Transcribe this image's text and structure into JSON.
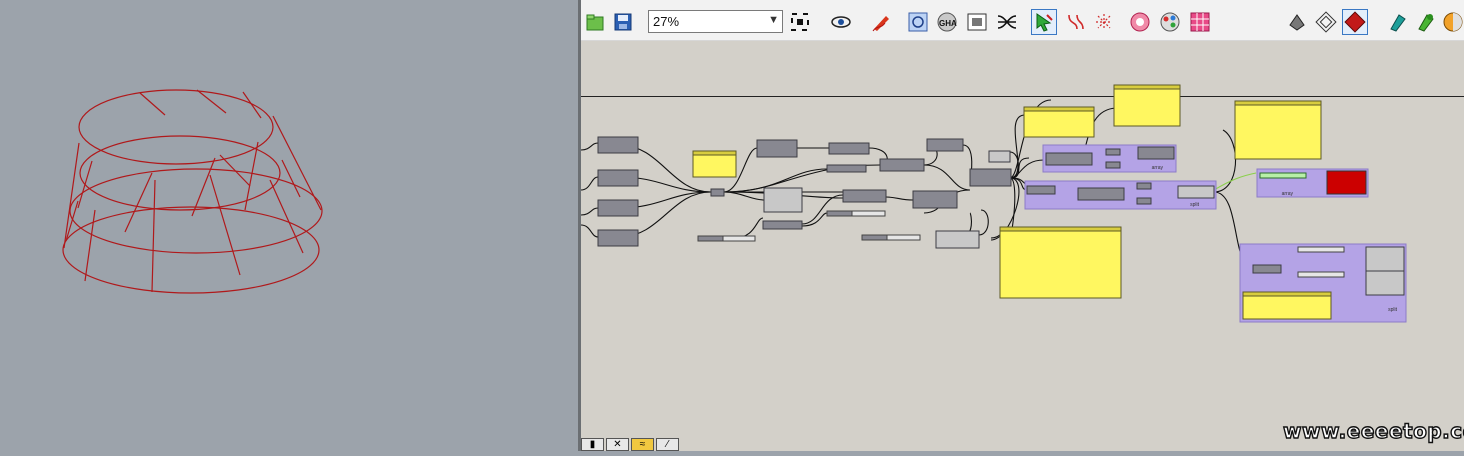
{
  "toolbar": {
    "zoom_value": "27%",
    "icons": [
      "open-file-icon",
      "save-file-icon",
      "zoom-extents-icon",
      "preview-eye-icon",
      "sketch-pen-icon",
      "bake-cluster-icon",
      "gha-assembly-icon",
      "image-export-icon",
      "connect-wires-icon",
      "select-cursor-icon",
      "probe-icon",
      "relay-icon",
      "cluster-ring-icon",
      "palette-icon",
      "grid-table-icon",
      "shaded-preview-icon",
      "wireframe-preview-icon",
      "red-cube-icon",
      "teal-brush-icon",
      "green-brush-icon",
      "color-wheel-icon"
    ]
  },
  "canvas": {
    "group_labels": [
      "array",
      "split",
      "array",
      "split"
    ]
  },
  "colors": {
    "viewport_bg": "#9ca3ab",
    "canvas_bg": "#d3d0c9",
    "panel_yellow": "#fff760",
    "group_purple": "#b4a3e6",
    "component_gray": "#888891",
    "wire_color": "#111111",
    "wireframe_red": "#b0191b",
    "swatch_red": "#cc0000"
  },
  "bottom_tools": [
    "pin",
    "close",
    "sketch",
    "brush"
  ],
  "watermark": "www.eeeetop.com"
}
